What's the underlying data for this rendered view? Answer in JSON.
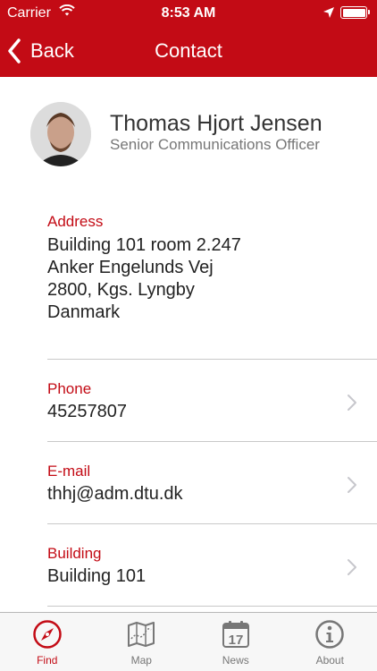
{
  "status_bar": {
    "carrier": "Carrier",
    "time": "8:53 AM"
  },
  "nav": {
    "back_label": "Back",
    "title": "Contact"
  },
  "person": {
    "name": "Thomas Hjort Jensen",
    "title": "Senior Communications Officer"
  },
  "address": {
    "label": "Address",
    "lines": [
      "Building 101 room 2.247",
      "Anker Engelunds Vej",
      "2800, Kgs. Lyngby",
      "Danmark"
    ]
  },
  "rows": [
    {
      "label": "Phone",
      "value": "45257807"
    },
    {
      "label": "E-mail",
      "value": "thhj@adm.dtu.dk"
    },
    {
      "label": "Building",
      "value": "Building 101"
    }
  ],
  "tabs": [
    {
      "label": "Find",
      "icon": "compass-icon",
      "active": true
    },
    {
      "label": "Map",
      "icon": "map-icon",
      "active": false
    },
    {
      "label": "News",
      "icon": "calendar-icon",
      "calendar_day": "17",
      "active": false
    },
    {
      "label": "About",
      "icon": "info-icon",
      "active": false
    }
  ],
  "colors": {
    "accent": "#c30b15",
    "tab_inactive": "#777777",
    "background": "#ffffff"
  }
}
